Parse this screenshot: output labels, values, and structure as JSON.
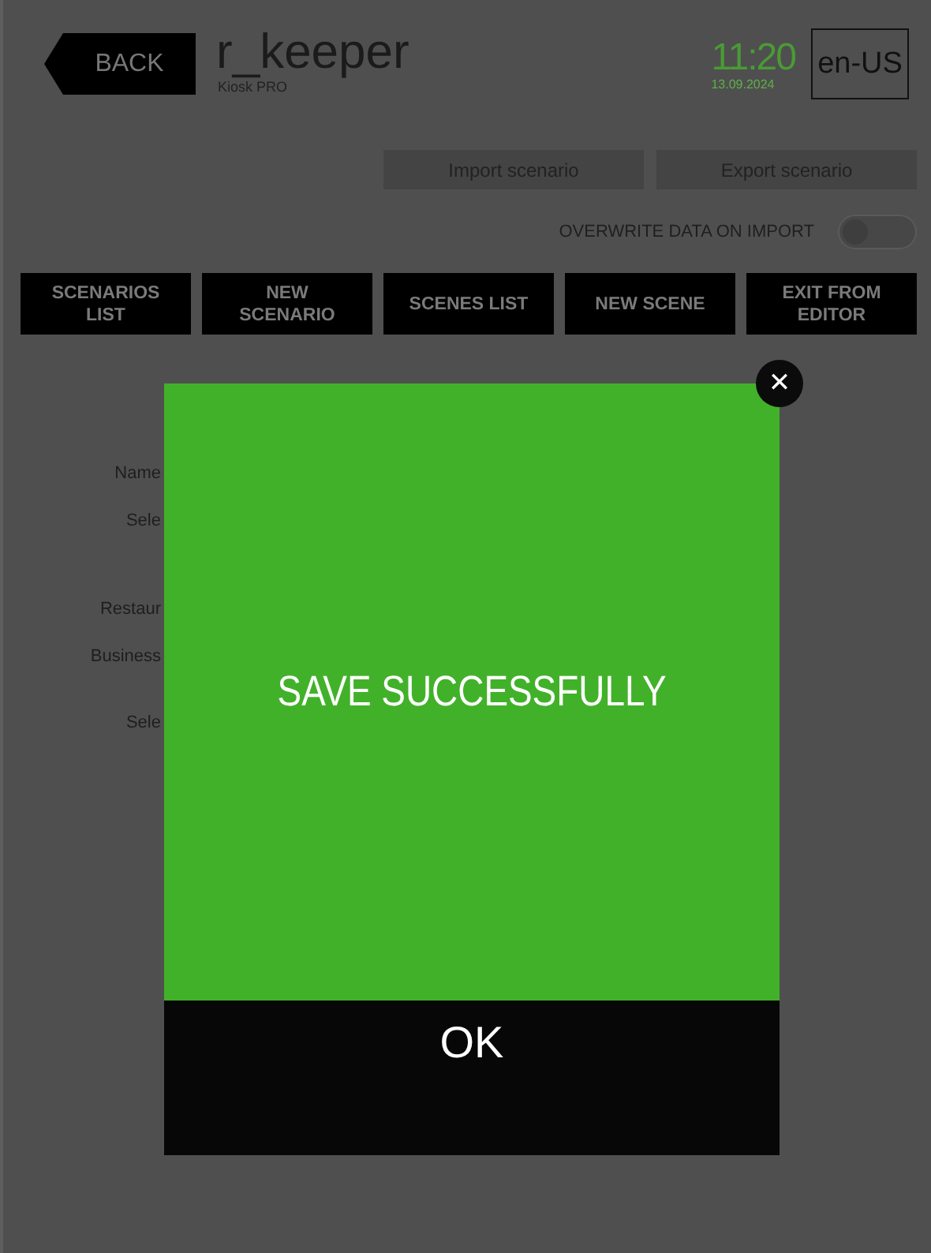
{
  "header": {
    "back": "BACK",
    "app_title": "r_keeper",
    "app_subtitle": "Kiosk PRO",
    "time": "11:20",
    "date": "13.09.2024",
    "language": "en-US"
  },
  "import_button": "Import scenario",
  "export_button": "Export scenario",
  "overwrite": {
    "label": "OVERWRITE DATA ON IMPORT",
    "on": false
  },
  "nav_buttons": [
    "SCENARIOS LIST",
    "NEW SCENARIO",
    "SCENES LIST",
    "NEW SCENE",
    "EXIT FROM EDITOR"
  ],
  "form_labels": [
    "Name",
    "Sele",
    "Restaur",
    "Business",
    "Sele"
  ],
  "dialog": {
    "message": "SAVE SUCCESSFULLY",
    "ok": "OK",
    "close": "✕"
  }
}
